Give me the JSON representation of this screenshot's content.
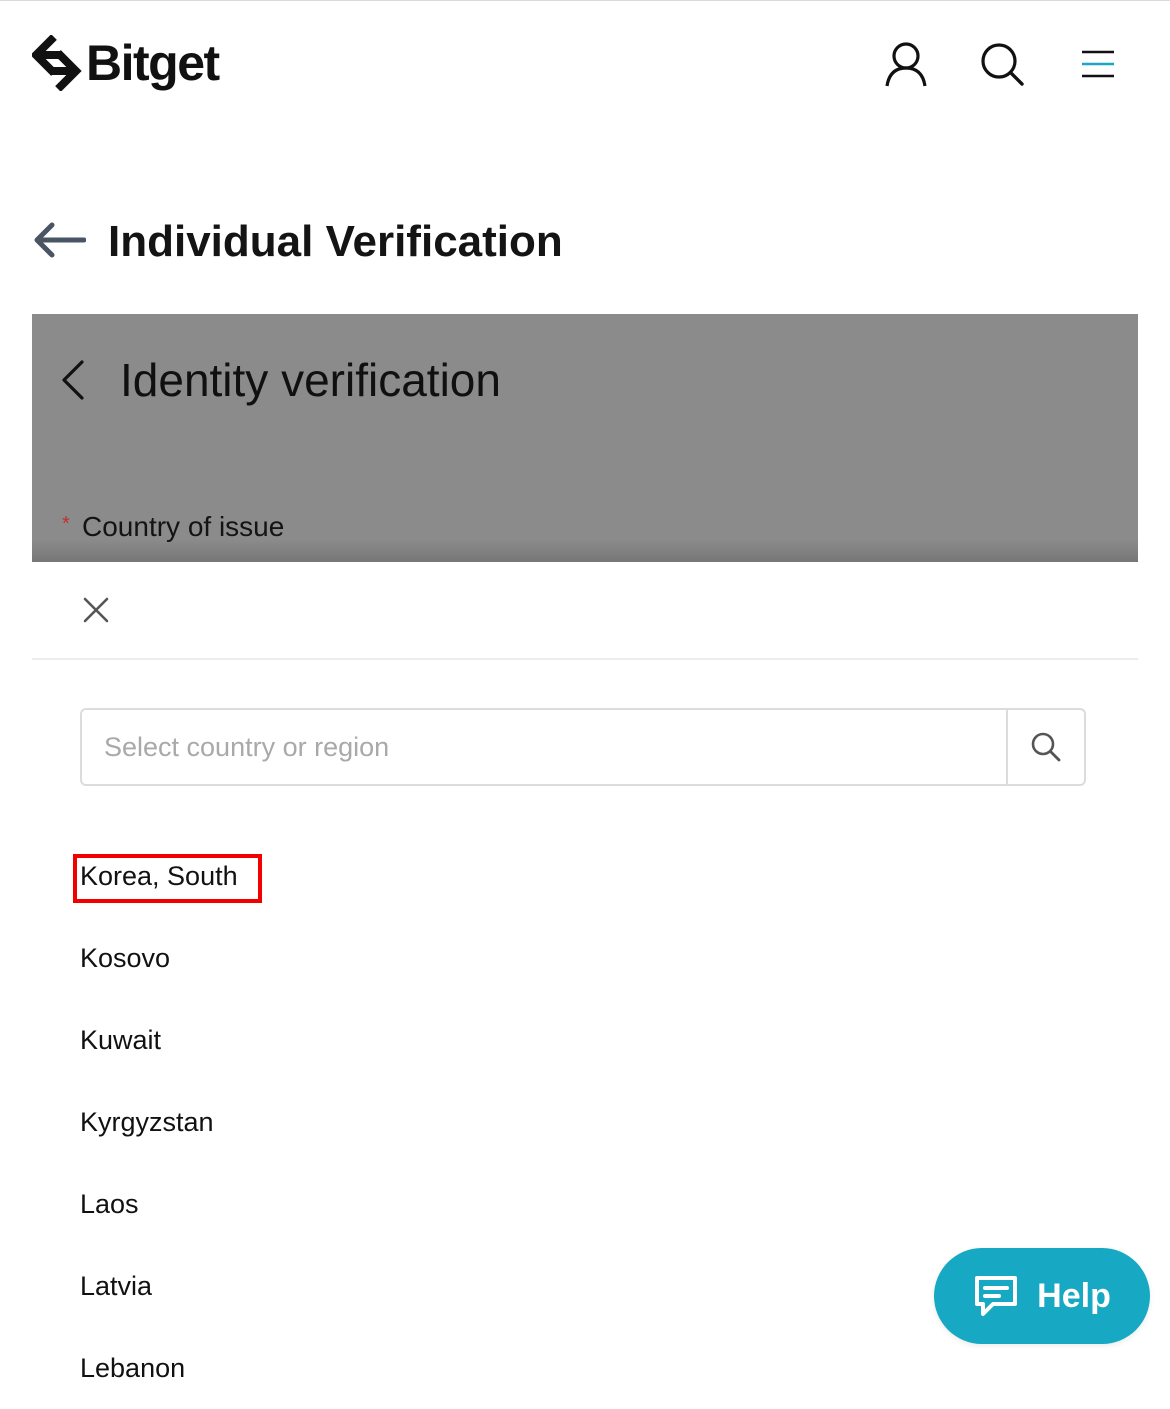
{
  "header": {
    "logo_text": "Bitget",
    "icons": [
      "user-icon",
      "search-icon",
      "menu-icon"
    ]
  },
  "page": {
    "title": "Individual Verification"
  },
  "overlay": {
    "title": "Identity verification",
    "required_mark": "*",
    "field_label": "Country of issue"
  },
  "sheet": {
    "search_placeholder": "Select country or region",
    "countries": [
      "Korea, South",
      "Kosovo",
      "Kuwait",
      "Kyrgyzstan",
      "Laos",
      "Latvia",
      "Lebanon"
    ],
    "highlighted": "Korea, South"
  },
  "help": {
    "label": "Help"
  },
  "colors": {
    "accent": "#17a9c4",
    "overlay": "#8b8b8b",
    "highlight_border": "#f20000"
  }
}
